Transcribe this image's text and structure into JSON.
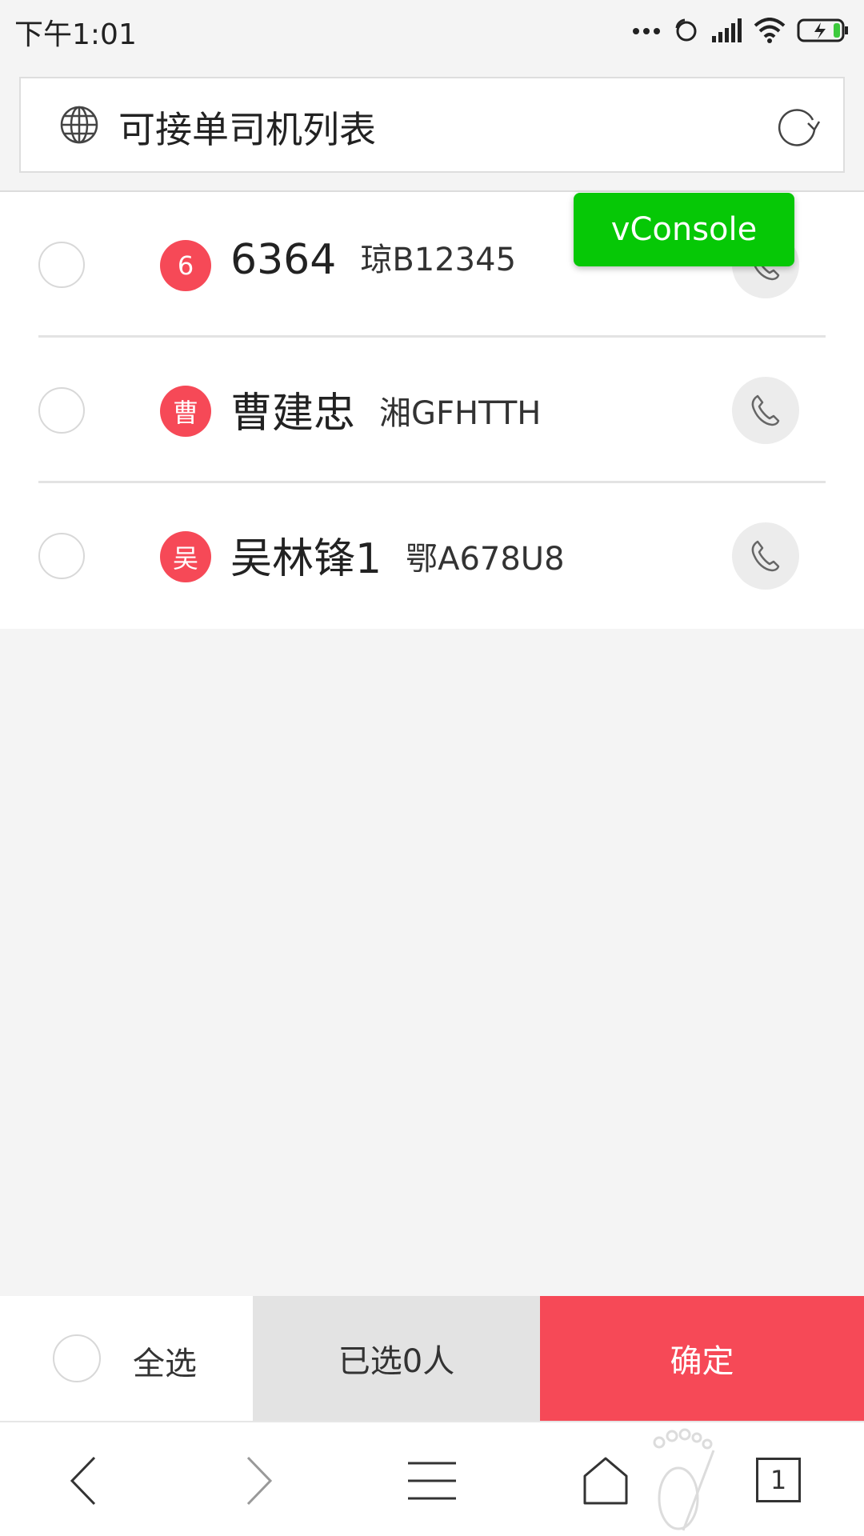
{
  "status_bar": {
    "time": "下午1:01",
    "icons": [
      "more-dots-icon",
      "sync-icon",
      "signal-icon",
      "wifi-icon",
      "battery-charging-icon"
    ]
  },
  "address_bar": {
    "title": "可接单司机列表",
    "left_icon": "globe-icon",
    "right_icon": "reload-icon"
  },
  "driver_list": [
    {
      "avatar_char": "6",
      "name": "6364",
      "plate": "琼B12345",
      "selected": false
    },
    {
      "avatar_char": "曹",
      "name": "曹建忠",
      "plate": "湘GFHTTH",
      "selected": false
    },
    {
      "avatar_char": "吴",
      "name": "吴林锋1",
      "plate": "鄂A678U8",
      "selected": false
    }
  ],
  "vconsole": {
    "label": "vConsole"
  },
  "action_bar": {
    "select_all_label": "全选",
    "selected_count_label": "已选0人",
    "confirm_label": "确定"
  },
  "browser_nav": {
    "tab_count": "1",
    "icons": [
      "back-icon",
      "forward-icon",
      "menu-icon",
      "home-icon",
      "tabs-icon"
    ]
  },
  "colors": {
    "accent_red": "#f64957",
    "vconsole_green": "#06c806",
    "background": "#f4f4f4"
  }
}
